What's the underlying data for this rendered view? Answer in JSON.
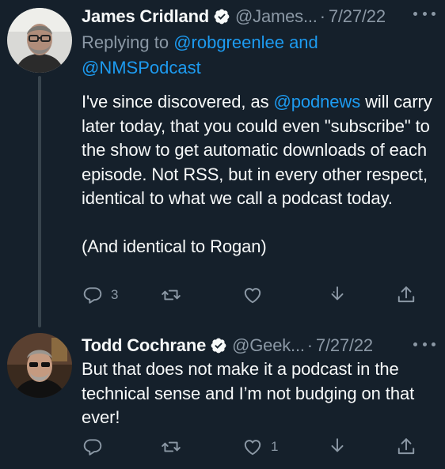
{
  "colors": {
    "background": "#15202b",
    "text_primary": "#f7f9f9",
    "text_secondary": "#8b98a5",
    "accent": "#1d9bf0",
    "thread_line": "#38444d"
  },
  "tweets": [
    {
      "author_name": "James Cridland",
      "verified": true,
      "handle": "@James...",
      "separator": "·",
      "date": "7/27/22",
      "replying_to_prefix": "Replying to ",
      "replying_to_user1": "@robgreenlee",
      "replying_to_joiner": " and",
      "replying_to_user2": "@NMSPodcast",
      "body_part1": "I've since discovered, as ",
      "body_mention": "@podnews",
      "body_part2": " will carry later today, that you could even \"subscribe\" to the show to get automatic downloads of each episode. Not RSS, but in every other respect, identical to what we call a podcast today.",
      "body_paragraph2": "(And identical to Rogan)",
      "reply_count": "3",
      "retweet_count": "",
      "like_count": ""
    },
    {
      "author_name": "Todd Cochrane",
      "verified": true,
      "handle": "@Geek...",
      "separator": "·",
      "date": "7/27/22",
      "body": "But that does not make it a podcast in the technical sense and I’m not budging on that ever!",
      "reply_count": "",
      "retweet_count": "",
      "like_count": "1"
    }
  ],
  "icons": {
    "more": "more-horizontal-icon",
    "reply": "reply-icon",
    "retweet": "retweet-icon",
    "like": "heart-icon",
    "download": "download-icon",
    "share": "share-icon",
    "verified": "verified-badge-icon"
  }
}
